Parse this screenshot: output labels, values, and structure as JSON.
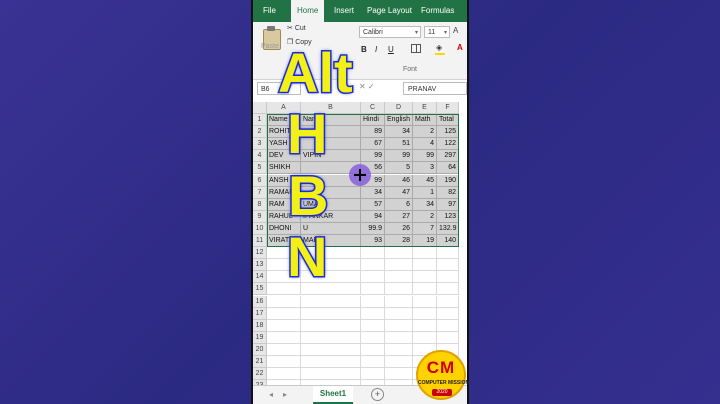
{
  "ribbon_tabs": [
    "File",
    "Home",
    "Insert",
    "Page Layout",
    "Formulas"
  ],
  "active_tab": "Home",
  "clipboard": {
    "paste": "Paste",
    "cut": "Cut",
    "copy": "Copy"
  },
  "font": {
    "name": "Calibri",
    "size": "11",
    "bold": "B",
    "italic": "I",
    "underline": "U",
    "grow": "A",
    "color_glyph": "A",
    "group_label": "Font"
  },
  "formula_bar": {
    "name_box": "B6",
    "formula": "PRANAV"
  },
  "columns": [
    "A",
    "B",
    "C",
    "D",
    "E",
    "F"
  ],
  "rows": [
    [
      "Name",
      "Name",
      "Hindi",
      "English",
      "Math",
      "Total"
    ],
    [
      "ROHIT",
      "",
      "89",
      "34",
      "2",
      "125"
    ],
    [
      "YASH",
      "",
      "67",
      "51",
      "4",
      "122"
    ],
    [
      "DEV",
      "VIPIN",
      "99",
      "99",
      "99",
      "297"
    ],
    [
      "SHIKH",
      "",
      "56",
      "5",
      "3",
      "64"
    ],
    [
      "ANSH",
      "",
      "99",
      "46",
      "45",
      "190"
    ],
    [
      "RAMAN",
      "",
      "34",
      "47",
      "1",
      "82"
    ],
    [
      "RAM",
      "UMAR",
      "57",
      "6",
      "34",
      "97"
    ],
    [
      "RAHUL",
      "IPANKAR",
      "94",
      "27",
      "2",
      "123"
    ],
    [
      "DHONI",
      "U",
      "99.9",
      "26",
      "7",
      "132.9"
    ],
    [
      "VIRAT",
      "MAR",
      "93",
      "28",
      "19",
      "140"
    ]
  ],
  "row_numbers": [
    "1",
    "2",
    "3",
    "4",
    "5",
    "6",
    "7",
    "8",
    "9",
    "10",
    "11",
    "12",
    "13",
    "14",
    "15",
    "16",
    "17",
    "18",
    "19",
    "20",
    "21",
    "22",
    "23"
  ],
  "sheet": {
    "tab": "Sheet1",
    "add": "+"
  },
  "overlay_keys": {
    "alt": "Alt",
    "h": "H",
    "b": "B",
    "n": "N"
  },
  "logo": {
    "text": "CM",
    "subtitle": "COMPUTER MISSION",
    "year": "2020"
  },
  "colors": {
    "excel_green": "#217346",
    "key_yellow": "#f3f018",
    "key_outline": "#1f2fd0",
    "background": "#2e2a86"
  },
  "icons": [
    "scissors-icon",
    "copy-icon",
    "paste-icon",
    "borders-icon",
    "fill-color-icon",
    "font-color-icon",
    "add-sheet-icon"
  ]
}
